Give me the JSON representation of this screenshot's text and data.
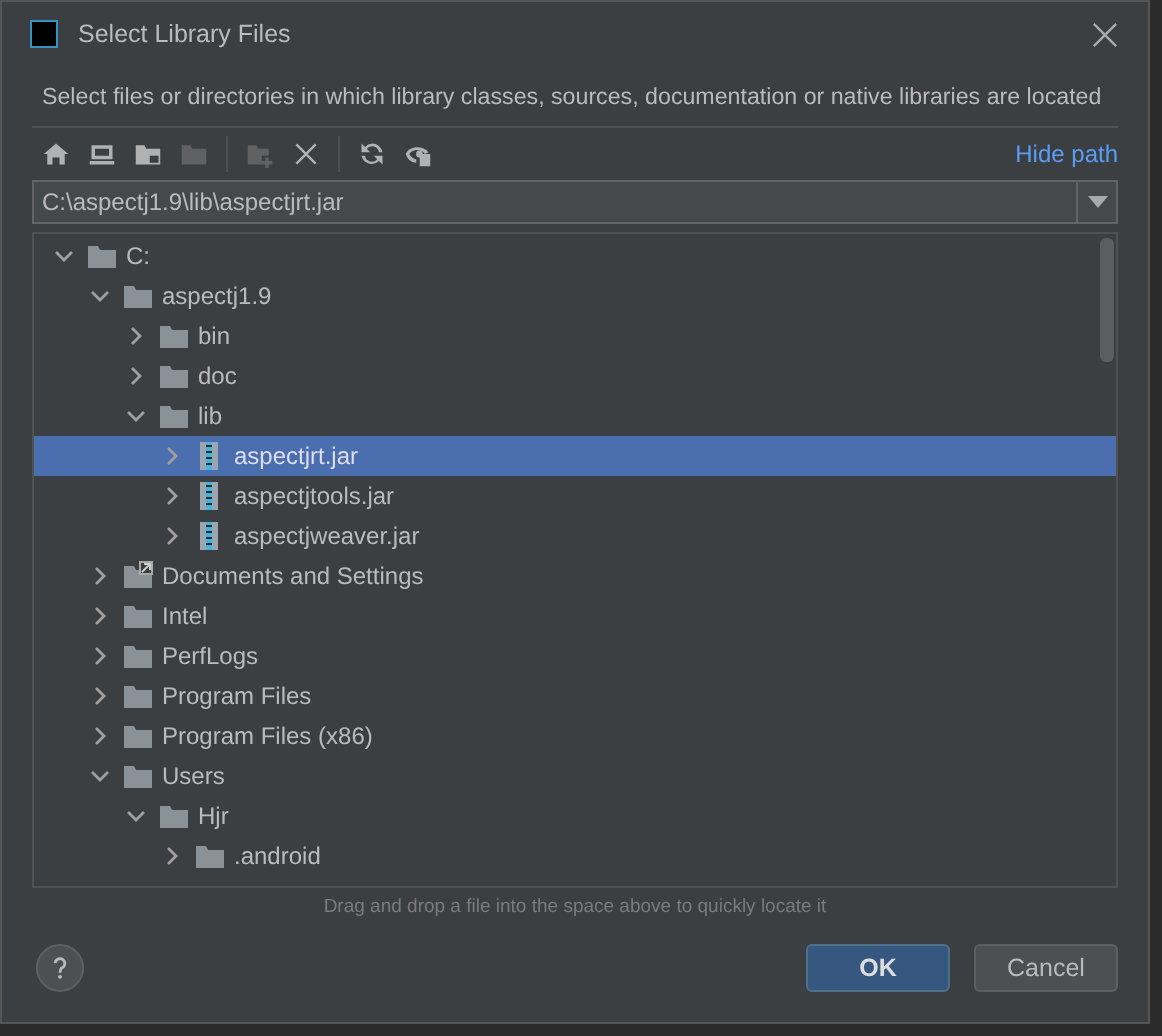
{
  "window": {
    "title": "Select Library Files"
  },
  "description": "Select files or directories in which library classes, sources, documentation or native libraries are located",
  "toolbar": [
    {
      "disabled": false
    },
    {
      "disabled": false
    },
    {
      "disabled": false
    },
    {
      "disabled": true
    },
    {
      "disabled": true
    },
    {
      "disabled": false
    },
    {
      "disabled": false
    },
    {
      "disabled": false
    }
  ],
  "hide_path_link": "Hide path",
  "path_field": {
    "value": "C:\\aspectj1.9\\lib\\aspectjrt.jar"
  },
  "tree": [
    {
      "label": "C:",
      "kind": "folder",
      "expanded": true,
      "selected": false,
      "children": [
        {
          "label": "aspectj1.9",
          "kind": "folder",
          "expanded": true,
          "selected": false,
          "children": [
            {
              "label": "bin",
              "kind": "folder",
              "expanded": false,
              "selected": false
            },
            {
              "label": "doc",
              "kind": "folder",
              "expanded": false,
              "selected": false
            },
            {
              "label": "lib",
              "kind": "folder",
              "expanded": true,
              "selected": false,
              "children": [
                {
                  "label": "aspectjrt.jar",
                  "kind": "jar",
                  "expanded": false,
                  "selected": true
                },
                {
                  "label": "aspectjtools.jar",
                  "kind": "jar",
                  "expanded": false,
                  "selected": false
                },
                {
                  "label": "aspectjweaver.jar",
                  "kind": "jar",
                  "expanded": false,
                  "selected": false
                }
              ]
            }
          ]
        },
        {
          "label": "Documents and Settings",
          "kind": "link",
          "expanded": false,
          "selected": false
        },
        {
          "label": "Intel",
          "kind": "folder",
          "expanded": false,
          "selected": false
        },
        {
          "label": "PerfLogs",
          "kind": "folder",
          "expanded": false,
          "selected": false
        },
        {
          "label": "Program Files",
          "kind": "folder",
          "expanded": false,
          "selected": false
        },
        {
          "label": "Program Files (x86)",
          "kind": "folder",
          "expanded": false,
          "selected": false
        },
        {
          "label": "Users",
          "kind": "folder",
          "expanded": true,
          "selected": false,
          "children": [
            {
              "label": "Hjr",
              "kind": "folder",
              "expanded": true,
              "selected": false,
              "children": [
                {
                  "label": ".android",
                  "kind": "folder",
                  "expanded": false,
                  "selected": false
                }
              ]
            }
          ]
        }
      ]
    }
  ],
  "hint": "Drag and drop a file into the space above to quickly locate it",
  "buttons": [
    {
      "label": "OK",
      "kind": "primary"
    },
    {
      "label": "Cancel",
      "kind": "secondary"
    }
  ]
}
